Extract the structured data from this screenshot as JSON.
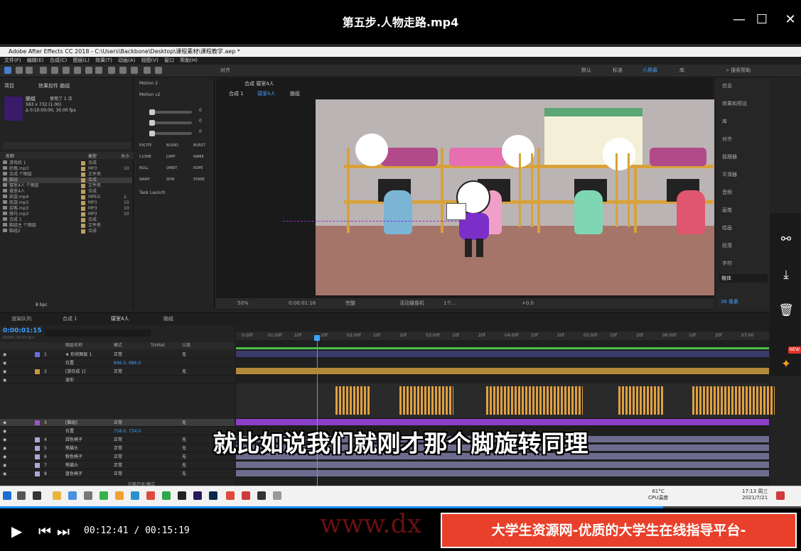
{
  "player": {
    "title": "第五步.人物走路.mp4",
    "current_time": "00:12:41",
    "separator": "/",
    "duration": "00:15:19",
    "progress": 0.828,
    "window_controls": [
      "minimize-icon",
      "maximize-icon",
      "close-icon"
    ]
  },
  "ae": {
    "window_title": "Adobe After Effects CC 2018 - C:\\Users\\Backbone\\Desktop\\课程素材\\课程教学.aep *",
    "menu": [
      "文件(F)",
      "编辑(E)",
      "合成(C)",
      "图层(L)",
      "效果(T)",
      "动画(A)",
      "视图(V)",
      "窗口",
      "帮助(H)"
    ],
    "toolbar_snap": "对齐",
    "workspaces": [
      "默认",
      "标准",
      "小屏幕",
      "库"
    ],
    "search_help": "搜索帮助",
    "project": {
      "tab_project": "项目",
      "tab_effects": "效果控件 脑组",
      "item_name": "脑组",
      "item_used": "使用了 1 次",
      "item_size": "583 x 732 (1.00)",
      "item_duration": "Δ 0:10:00:00, 30.00 fps",
      "col_name": "名称",
      "col_type": "类型",
      "col_size": "大小",
      "rows": [
        {
          "name": "游戏机 1",
          "type": "合成",
          "size": ""
        },
        {
          "name": "奶瓶.mp3",
          "type": "MP3",
          "size": "10"
        },
        {
          "name": "合成 个图层",
          "type": "文件夹",
          "size": ""
        },
        {
          "name": "脑组",
          "type": "合成",
          "size": ""
        },
        {
          "name": "寝室4人 个图层",
          "type": "文件夹",
          "size": ""
        },
        {
          "name": "寝室4人",
          "type": "合成",
          "size": ""
        },
        {
          "name": "凯旋.mp4",
          "type": "MPEG",
          "size": "2."
        },
        {
          "name": "凯旋.mp3",
          "type": "MP3",
          "size": "10"
        },
        {
          "name": "迎客.mp3",
          "type": "MP3",
          "size": "10"
        },
        {
          "name": "骑马.mp3",
          "type": "MP3",
          "size": "10"
        },
        {
          "name": "合成 1",
          "type": "合成",
          "size": ""
        },
        {
          "name": "脑组主 个图层",
          "type": "文件夹",
          "size": ""
        },
        {
          "name": "脑组2",
          "type": "合成",
          "size": ""
        }
      ],
      "bpc": "8 bpc"
    },
    "effects": {
      "header": "Motion 2",
      "preset": "Motion v2",
      "slider_values": [
        "0",
        "0",
        "0",
        "0"
      ],
      "buttons": [
        "EXCITE",
        "BLEND",
        "BURST",
        "CLONE",
        "JUMP",
        "NAME",
        "NULL",
        "ORBIT",
        "ROPE",
        "WARP",
        "SPIN",
        "STARE"
      ],
      "task": "Task Launch"
    },
    "viewer": {
      "tab": "合成 寝室4人",
      "breadcrumb": [
        "合成 1",
        "寝室4人",
        "脑组"
      ],
      "zoom": "50%",
      "timecode": "0:00:01:16",
      "quality": "完整",
      "camera": "活动摄像机",
      "views": "1个...",
      "exposure": "+0.0"
    },
    "right_panel": [
      "信息",
      "效果和预设",
      "库",
      "对齐",
      "摇摆器",
      "平滑器",
      "音频",
      "画笔",
      "绘画",
      "段落",
      "字符"
    ],
    "font_name": "楷体",
    "font_size": "36 像素",
    "timeline": {
      "tabs": [
        "渲染队列",
        "合成 1",
        "寝室4人",
        "脑组"
      ],
      "timecode": "0:00:01:15",
      "timecode_sub": "00045 (30.00 fps)",
      "headers": {
        "name": "图层名称",
        "mode": "模式",
        "trkmat": "TrkMat",
        "parent": "父级"
      },
      "ruler": [
        "0:00f",
        "01:00f",
        "10f",
        "20f",
        "02:00f",
        "10f",
        "20f",
        "03:00f",
        "10f",
        "20f",
        "04:00f",
        "10f",
        "20f",
        "05:00f",
        "10f",
        "20f",
        "06:00f",
        "10f",
        "20f",
        "07:00"
      ],
      "layers": [
        {
          "num": "1",
          "name": "★ 形状图层 1",
          "mode": "正常",
          "parent": "无",
          "color": "#6a6ae0"
        },
        {
          "num": "",
          "name": "位置",
          "mode": "846.0, 686.0",
          "parent": "",
          "color": ""
        },
        {
          "num": "2",
          "name": "[游合成 1]",
          "mode": "正常",
          "parent": "无",
          "color": "#c89a3a"
        },
        {
          "num": "",
          "name": "波形",
          "mode": "",
          "parent": "",
          "color": ""
        },
        {
          "num": "3",
          "name": "[脑组]",
          "mode": "正常",
          "parent": "无",
          "color": "#9b55c8"
        },
        {
          "num": "",
          "name": "位置",
          "mode": "758.0, 734.0",
          "parent": "",
          "color": ""
        },
        {
          "num": "4",
          "name": "绿色椅子",
          "mode": "正常",
          "parent": "无",
          "color": "#aaa8d8"
        },
        {
          "num": "5",
          "name": "熊猫头",
          "mode": "正常",
          "parent": "无",
          "color": "#aaa8d8"
        },
        {
          "num": "6",
          "name": "粉色椅子",
          "mode": "正常",
          "parent": "无",
          "color": "#aaa8d8"
        },
        {
          "num": "7",
          "name": "熊猫头",
          "mode": "正常",
          "parent": "无",
          "color": "#aaa8d8"
        },
        {
          "num": "8",
          "name": "蓝色椅子",
          "mode": "正常",
          "parent": "无",
          "color": "#aaa8d8"
        }
      ],
      "footer": "切换开关/模式"
    }
  },
  "subtitle": "就比如说我们就刚才那个脚旋转同理",
  "taskbar": {
    "temp": "61°C",
    "temp_label": "CPU温度",
    "time": "17:13 周三",
    "date": "2021/7/21"
  },
  "side_buttons": [
    "share-icon",
    "download-icon",
    "trash-icon",
    "pin-icon"
  ],
  "new_badge": "NEW",
  "watermark": "www.dx",
  "ad_banner": "大学生资源网-优质的大学生在线指导平台-www.dxszyw.cn"
}
